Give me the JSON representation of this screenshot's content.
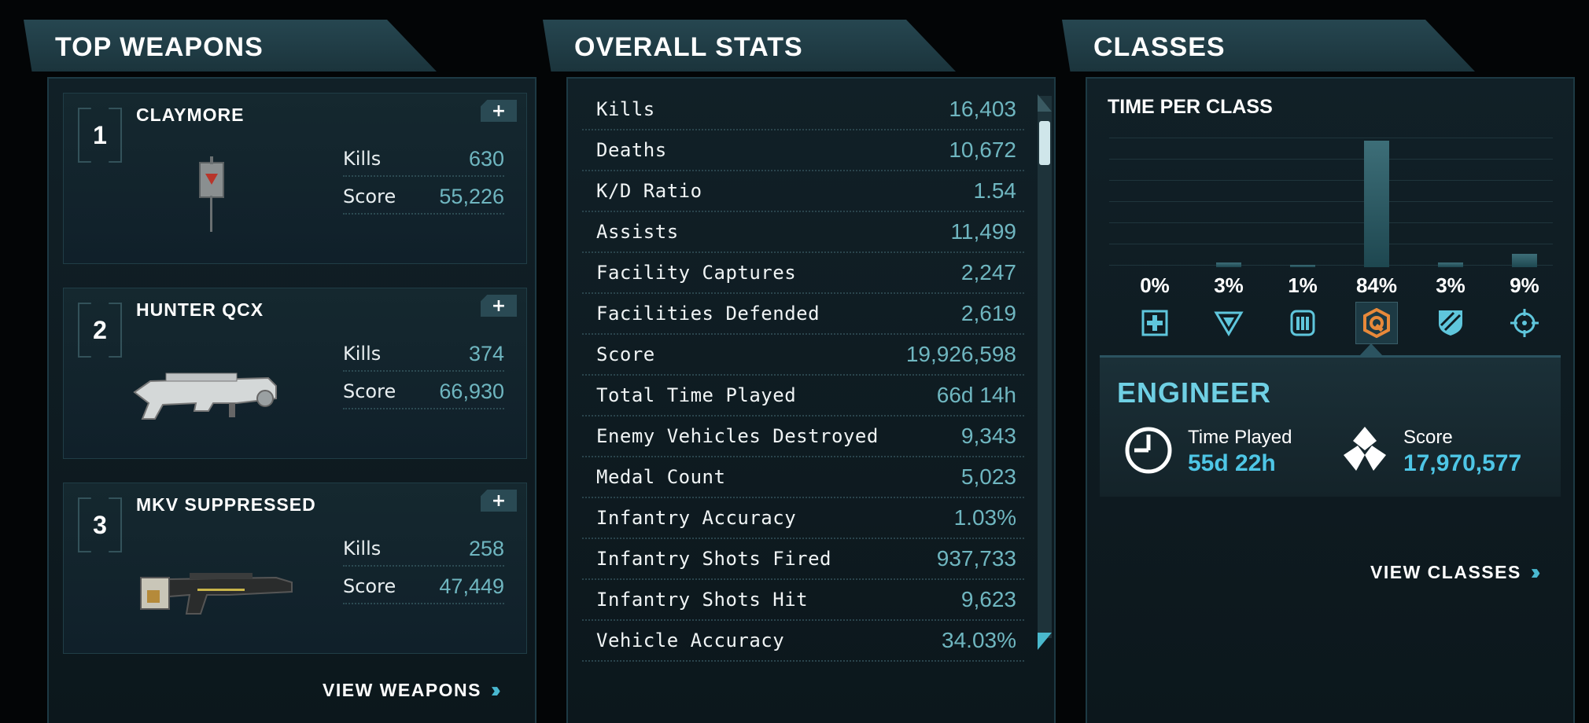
{
  "weapons": {
    "title": "TOP WEAPONS",
    "items": [
      {
        "rank": "1",
        "name": "CLAYMORE",
        "plus": "+",
        "kills_label": "Kills",
        "kills": "630",
        "score_label": "Score",
        "score": "55,226"
      },
      {
        "rank": "2",
        "name": "HUNTER QCX",
        "plus": "+",
        "kills_label": "Kills",
        "kills": "374",
        "score_label": "Score",
        "score": "66,930"
      },
      {
        "rank": "3",
        "name": "MKV SUPPRESSED",
        "plus": "+",
        "kills_label": "Kills",
        "kills": "258",
        "score_label": "Score",
        "score": "47,449"
      }
    ],
    "view_label": "VIEW WEAPONS"
  },
  "stats": {
    "title": "OVERALL STATS",
    "rows": [
      {
        "label": "Kills",
        "value": "16,403"
      },
      {
        "label": "Deaths",
        "value": "10,672"
      },
      {
        "label": "K/D Ratio",
        "value": "1.54"
      },
      {
        "label": "Assists",
        "value": "11,499"
      },
      {
        "label": "Facility Captures",
        "value": "2,247"
      },
      {
        "label": "Facilities Defended",
        "value": "2,619"
      },
      {
        "label": "Score",
        "value": "19,926,598"
      },
      {
        "label": "Total Time Played",
        "value": "66d 14h"
      },
      {
        "label": "Enemy Vehicles Destroyed",
        "value": "9,343"
      },
      {
        "label": "Medal Count",
        "value": "5,023"
      },
      {
        "label": "Infantry Accuracy",
        "value": "1.03%"
      },
      {
        "label": "Infantry Shots Fired",
        "value": "937,733"
      },
      {
        "label": "Infantry Shots Hit",
        "value": "9,623"
      },
      {
        "label": "Vehicle Accuracy",
        "value": "34.03%"
      }
    ]
  },
  "classes": {
    "title": "CLASSES",
    "subtitle": "TIME PER CLASS",
    "items": [
      {
        "pct_label": "0%",
        "value": 0,
        "icon": "medic-cross-icon"
      },
      {
        "pct_label": "3%",
        "value": 3,
        "icon": "infiltrator-triangle-icon"
      },
      {
        "pct_label": "1%",
        "value": 1,
        "icon": "ammo-icon"
      },
      {
        "pct_label": "84%",
        "value": 84,
        "icon": "engineer-wrench-icon",
        "selected": true
      },
      {
        "pct_label": "3%",
        "value": 3,
        "icon": "heavy-shield-icon"
      },
      {
        "pct_label": "9%",
        "value": 9,
        "icon": "crosshair-icon"
      }
    ],
    "selected": {
      "name": "ENGINEER",
      "time_label": "Time Played",
      "time_value": "55d 22h",
      "score_label": "Score",
      "score_value": "17,970,577"
    },
    "view_label": "VIEW CLASSES"
  },
  "colors": {
    "accent": "#6fd0e4",
    "value": "#6fb6c0",
    "selected_icon": "#e8893a"
  }
}
